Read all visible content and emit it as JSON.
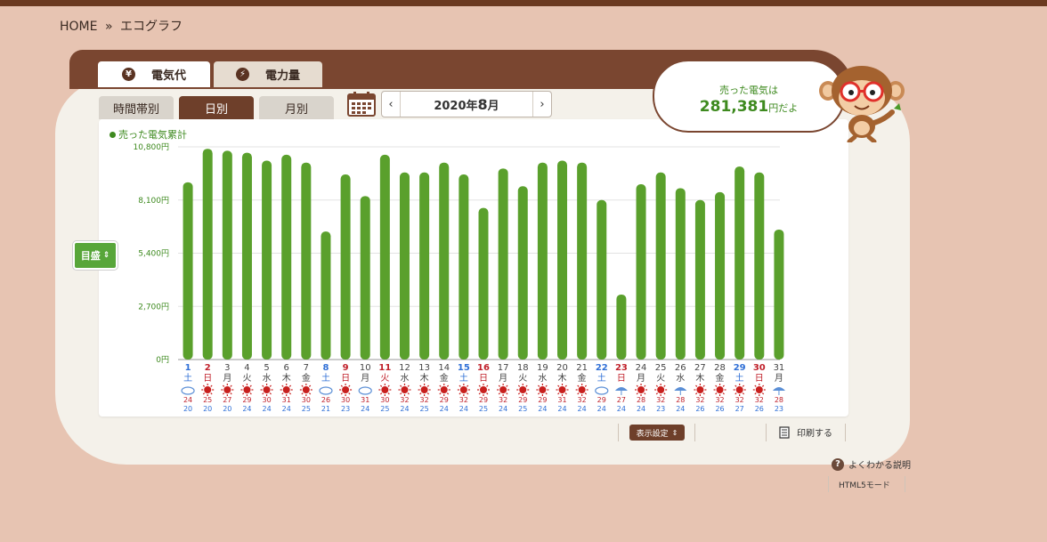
{
  "breadcrumb": {
    "home": "HOME",
    "sep": "»",
    "current": "エコグラフ"
  },
  "main_tabs": [
    {
      "icon": "yen-icon",
      "glyph": "¥",
      "label": "電気代",
      "active": true
    },
    {
      "icon": "lightning-icon",
      "glyph": "⚡",
      "label": "電力量",
      "active": false
    }
  ],
  "sub_tabs": [
    {
      "label": "時間帯別",
      "active": false
    },
    {
      "label": "日別",
      "active": true
    },
    {
      "label": "月別",
      "active": false
    }
  ],
  "date_nav": {
    "prev": "‹",
    "next": "›",
    "year_label": "2020年",
    "month_num": "8",
    "month_suffix": "月"
  },
  "legend": {
    "label": "売った電気累計"
  },
  "scale_button": {
    "label": "目盛",
    "glyph": "⇕"
  },
  "bubble": {
    "line1": "売った電気は",
    "amount": "281,381",
    "suffix": "円だよ"
  },
  "toolbar": {
    "display_settings": "表示設定",
    "print": "印刷する"
  },
  "footer": {
    "help": "よくわかる説明",
    "html5": "HTML5モード"
  },
  "colors": {
    "bar": "#5aa02c",
    "axis_text": "#3e8a1f",
    "sat": "#2f6fd6",
    "sun": "#c0202a",
    "weekday": "#444444"
  },
  "chart_data": {
    "type": "bar",
    "ylim": [
      0,
      10800
    ],
    "yticks": [
      {
        "v": 0,
        "label": "0円"
      },
      {
        "v": 2700,
        "label": "2,700円"
      },
      {
        "v": 5400,
        "label": "5,400円"
      },
      {
        "v": 8100,
        "label": "8,100円"
      },
      {
        "v": 10800,
        "label": "10,800円"
      }
    ],
    "categories": [
      "1",
      "2",
      "3",
      "4",
      "5",
      "6",
      "7",
      "8",
      "9",
      "10",
      "11",
      "12",
      "13",
      "14",
      "15",
      "16",
      "17",
      "18",
      "19",
      "20",
      "21",
      "22",
      "23",
      "24",
      "25",
      "26",
      "27",
      "28",
      "29",
      "30",
      "31"
    ],
    "weekdays": [
      "土",
      "日",
      "月",
      "火",
      "水",
      "木",
      "金",
      "土",
      "日",
      "月",
      "火",
      "水",
      "木",
      "金",
      "土",
      "日",
      "月",
      "火",
      "水",
      "木",
      "金",
      "土",
      "日",
      "月",
      "火",
      "水",
      "木",
      "金",
      "土",
      "日",
      "月"
    ],
    "day_type": [
      "sat",
      "sun",
      "wd",
      "wd",
      "wd",
      "wd",
      "wd",
      "sat",
      "sun",
      "wd",
      "sun",
      "wd",
      "wd",
      "wd",
      "sat",
      "sun",
      "wd",
      "wd",
      "wd",
      "wd",
      "wd",
      "sat",
      "sun",
      "wd",
      "wd",
      "wd",
      "wd",
      "wd",
      "sat",
      "sun",
      "wd"
    ],
    "weather": [
      "cloudy",
      "sunny",
      "sunny",
      "sunny",
      "sunny",
      "sunny",
      "sunny",
      "cloudy",
      "sunny",
      "cloudy",
      "sunny",
      "sunny",
      "sunny",
      "sunny",
      "sunny",
      "sunny",
      "sunny",
      "sunny",
      "sunny",
      "sunny",
      "sunny",
      "cloudy",
      "rainy",
      "sunny",
      "sunny",
      "rainy",
      "sunny",
      "sunny",
      "sunny",
      "sunny",
      "rainy"
    ],
    "high": [
      "24",
      "25",
      "27",
      "29",
      "30",
      "31",
      "30",
      "26",
      "30",
      "31",
      "30",
      "32",
      "32",
      "29",
      "32",
      "29",
      "32",
      "29",
      "29",
      "31",
      "32",
      "29",
      "27",
      "28",
      "32",
      "28",
      "32",
      "32",
      "32",
      "32",
      "28"
    ],
    "low": [
      "20",
      "20",
      "20",
      "24",
      "24",
      "24",
      "25",
      "21",
      "23",
      "24",
      "25",
      "24",
      "25",
      "24",
      "24",
      "25",
      "24",
      "25",
      "24",
      "24",
      "24",
      "24",
      "24",
      "24",
      "23",
      "24",
      "26",
      "26",
      "27",
      "26",
      "23"
    ],
    "values": [
      9000,
      10700,
      10600,
      10500,
      10100,
      10400,
      10000,
      6500,
      9400,
      8300,
      10400,
      9500,
      9500,
      10000,
      9400,
      7700,
      9700,
      8800,
      10000,
      10100,
      10000,
      8100,
      3300,
      8900,
      9500,
      8700,
      8100,
      8500,
      9800,
      9500,
      6600
    ]
  }
}
